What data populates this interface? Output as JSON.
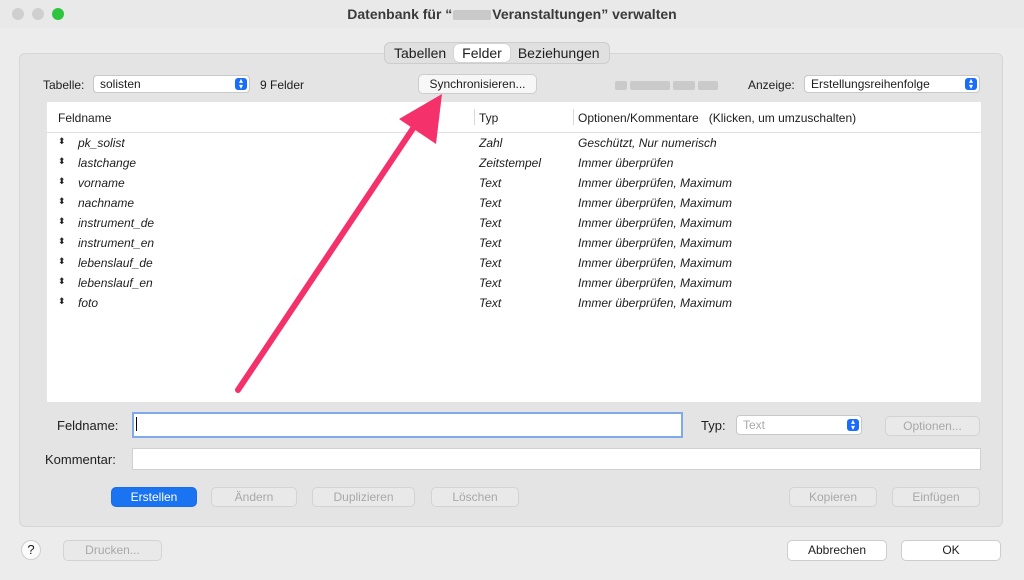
{
  "window": {
    "title_prefix": "Datenbank für “",
    "title_suffix": "Veranstaltungen” verwalten"
  },
  "tabs": [
    {
      "label": "Tabellen",
      "active": false
    },
    {
      "label": "Felder",
      "active": true
    },
    {
      "label": "Beziehungen",
      "active": false
    }
  ],
  "toolbar": {
    "table_label": "Tabelle:",
    "table_value": "solisten",
    "field_count": "9 Felder",
    "sync_button": "Synchronisieren...",
    "display_label": "Anzeige:",
    "display_value": "Erstellungsreihenfolge"
  },
  "table": {
    "headers": {
      "name": "Feldname",
      "type": "Typ",
      "options": "Optionen/Kommentare   (Klicken, um umzuschalten)"
    },
    "rows": [
      {
        "name": "pk_solist",
        "type": "Zahl",
        "options": "Geschützt, Nur numerisch"
      },
      {
        "name": "lastchange",
        "type": "Zeitstempel",
        "options": "Immer überprüfen"
      },
      {
        "name": "vorname",
        "type": "Text",
        "options": "Immer überprüfen, Maximum"
      },
      {
        "name": "nachname",
        "type": "Text",
        "options": "Immer überprüfen, Maximum"
      },
      {
        "name": "instrument_de",
        "type": "Text",
        "options": "Immer überprüfen, Maximum"
      },
      {
        "name": "instrument_en",
        "type": "Text",
        "options": "Immer überprüfen, Maximum"
      },
      {
        "name": "lebenslauf_de",
        "type": "Text",
        "options": "Immer überprüfen, Maximum"
      },
      {
        "name": "lebenslauf_en",
        "type": "Text",
        "options": "Immer überprüfen, Maximum"
      },
      {
        "name": "foto",
        "type": "Text",
        "options": "Immer überprüfen, Maximum"
      }
    ]
  },
  "form": {
    "fieldname_label": "Feldname:",
    "fieldname_value": "",
    "type_label": "Typ:",
    "type_value": "Text",
    "options_button": "Optionen...",
    "comment_label": "Kommentar:",
    "comment_value": ""
  },
  "actions": {
    "create": "Erstellen",
    "change": "Ändern",
    "duplicate": "Duplizieren",
    "delete": "Löschen",
    "copy": "Kopieren",
    "paste": "Einfügen"
  },
  "footer": {
    "help": "?",
    "print": "Drucken...",
    "cancel": "Abbrechen",
    "ok": "OK"
  },
  "colors": {
    "accent": "#1a73f0",
    "annotation_arrow": "#f5316c"
  }
}
